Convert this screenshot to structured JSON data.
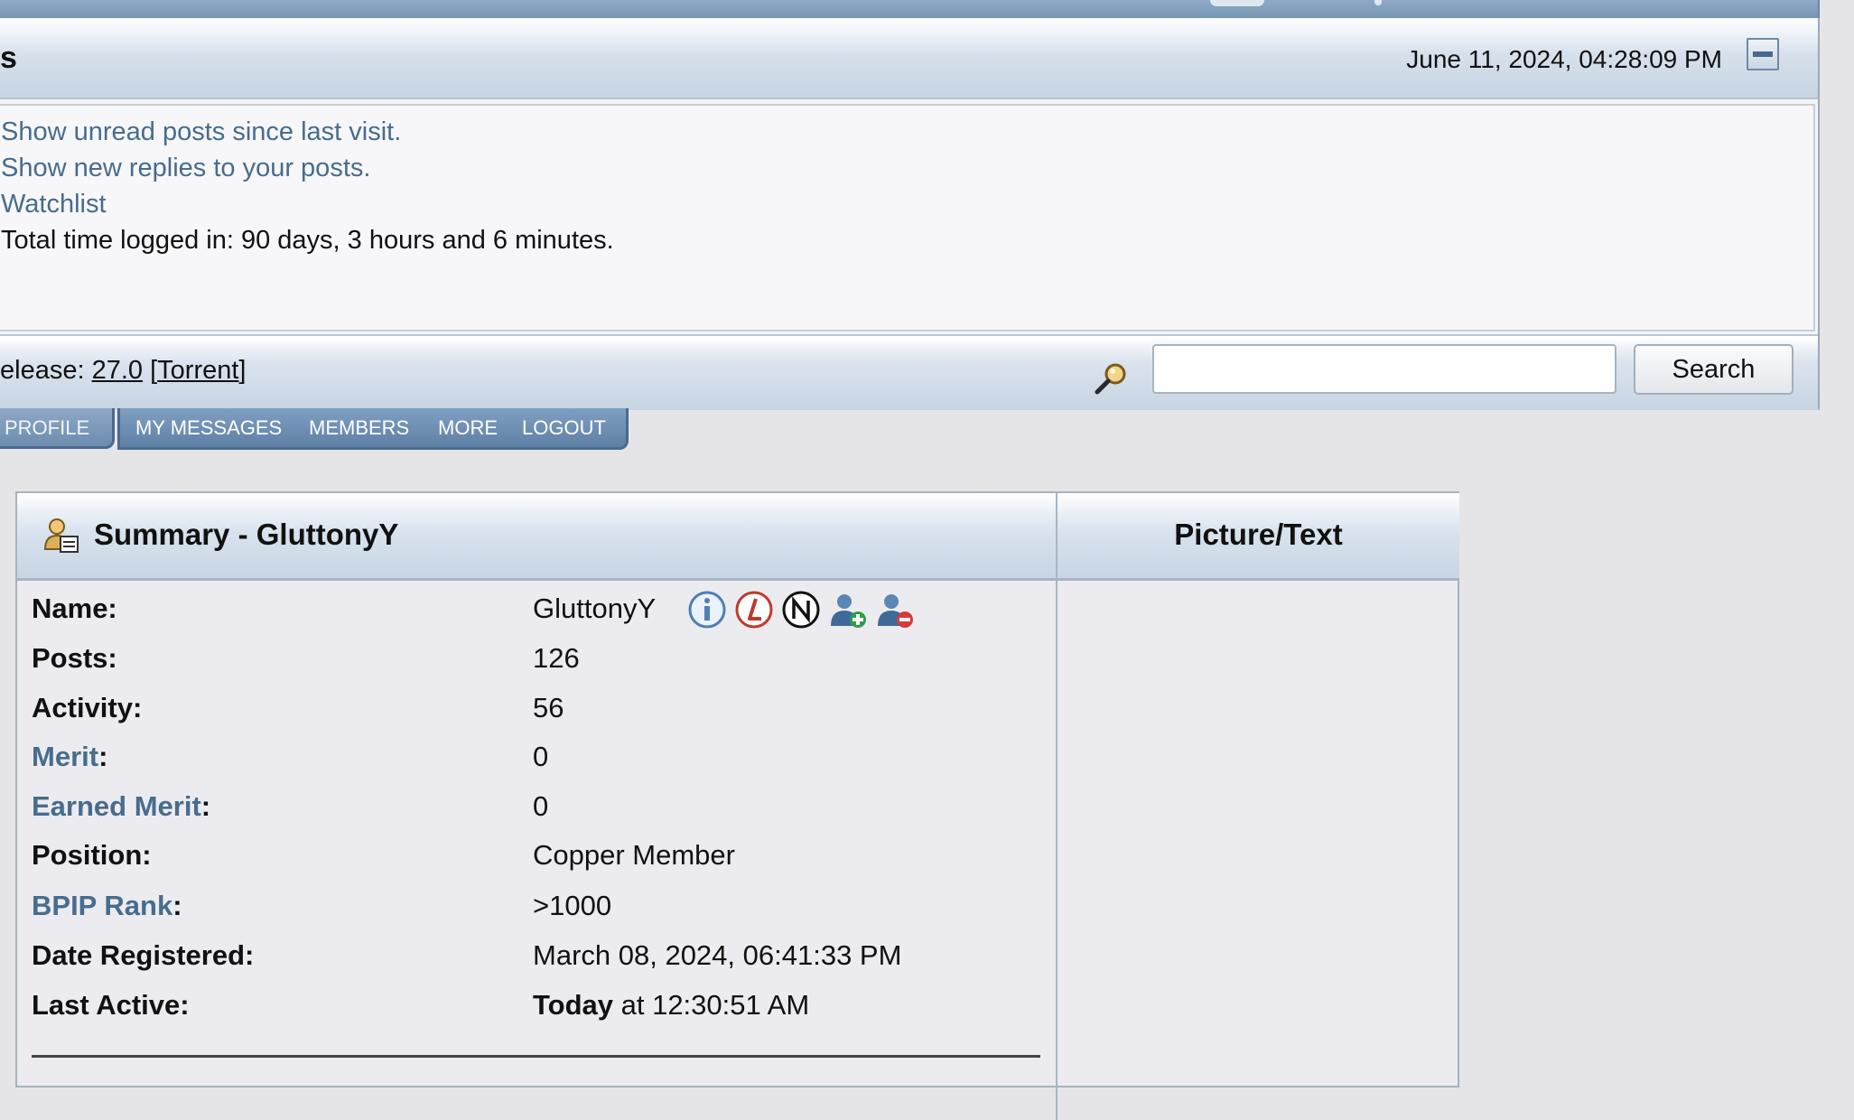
{
  "header": {
    "title": "s",
    "datetime": "June 11, 2024, 04:28:09 PM"
  },
  "links": {
    "unread": "Show unread posts since last visit.",
    "replies": "Show new replies to your posts.",
    "watchlist": "Watchlist",
    "time_logged": "Total time logged in: 90 days, 3 hours and 6 minutes."
  },
  "searchbar": {
    "release_prefix": "elease: ",
    "release_version": "27.0",
    "release_torrent": "Torrent",
    "search_placeholder": "",
    "search_button": "Search"
  },
  "tabs": {
    "active": "PROFILE",
    "items": [
      "MY MESSAGES",
      "MEMBERS",
      "MORE",
      "LOGOUT"
    ]
  },
  "summary": {
    "title": "Summary - GluttonyY",
    "picture_title": "Picture/Text",
    "rows": {
      "name": {
        "label": "Name:",
        "value": "GluttonyY"
      },
      "posts": {
        "label": "Posts:",
        "value": "126"
      },
      "activity": {
        "label": "Activity:",
        "value": "56"
      },
      "merit": {
        "label_link": "Merit",
        "label_suffix": ":",
        "value": "0"
      },
      "earned_merit": {
        "label_link": "Earned Merit",
        "label_suffix": ":",
        "value": "0"
      },
      "position": {
        "label": "Position:",
        "value": "Copper Member"
      },
      "bpip": {
        "label_link": "BPIP Rank",
        "label_suffix": ":",
        "value": ">1000"
      },
      "registered": {
        "label": "Date Registered:",
        "value": "March 08, 2024, 06:41:33 PM"
      },
      "last_active": {
        "label": "Last Active:",
        "value_bold": "Today",
        "value_rest": " at 12:30:51 AM"
      }
    },
    "name_icons": [
      "info-icon",
      "loyce-l-icon",
      "ninjastic-n-icon",
      "add-buddy-icon",
      "ignore-user-icon"
    ]
  },
  "colors": {
    "link": "#476c8e",
    "tab_bg": "#6d8cae",
    "header_gradient_end": "#c8d5e4"
  }
}
